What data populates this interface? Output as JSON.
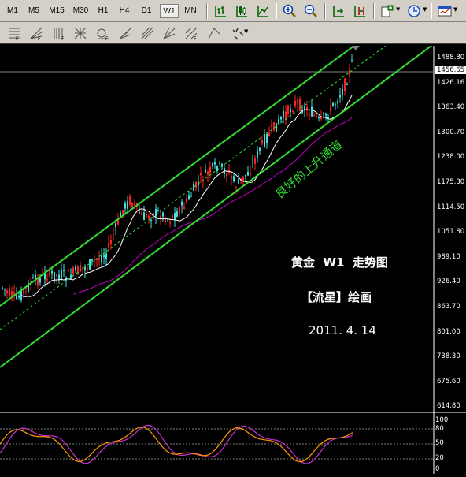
{
  "timeframes": [
    "M1",
    "M5",
    "M15",
    "M30",
    "H1",
    "H4",
    "D1",
    "W1",
    "MN"
  ],
  "active_timeframe": "W1",
  "toolbar_icons": [
    "bar-chart-icon",
    "candlestick-icon",
    "line-chart-icon",
    "zoom-in-icon",
    "zoom-out-icon",
    "auto-scroll-icon",
    "chart-shift-icon",
    "indicators-icon",
    "periods-icon",
    "templates-icon"
  ],
  "drawing_icons": [
    "fibo-retracement-icon",
    "fibo-fan-icon",
    "fibo-timezones-icon",
    "grid-icon",
    "cycle-lines-icon",
    "fibo-arcs-icon",
    "andrews-pitchfork-icon",
    "gann-fan-icon",
    "gann-grid-icon",
    "fibo-expansion-icon",
    "arrows-icon"
  ],
  "price_axis": [
    "1488.80",
    "1426.16",
    "1363.40",
    "1300.70",
    "1238.00",
    "1175.30",
    "1114.50",
    "1051.80",
    "989.10",
    "926.40",
    "863.70",
    "801.00",
    "738.30",
    "675.60",
    "614.80"
  ],
  "current_price": "1456.65",
  "oscillator_axis": [
    "100",
    "80",
    "50",
    "20",
    "0"
  ],
  "annotations": {
    "channel_label": "良好的上升通道",
    "title": "黄金  W1  走势图",
    "author": "【流星】绘画",
    "date": "2011. 4. 14"
  },
  "colors": {
    "bull_candle": "#ff2020",
    "bear_candle": "#40e0e0",
    "channel": "#33dd33",
    "ma_fast": "#ffffff",
    "ma_slow": "#c000c0",
    "stoch_main": "#ff9900",
    "stoch_signal": "#cc33cc"
  }
}
